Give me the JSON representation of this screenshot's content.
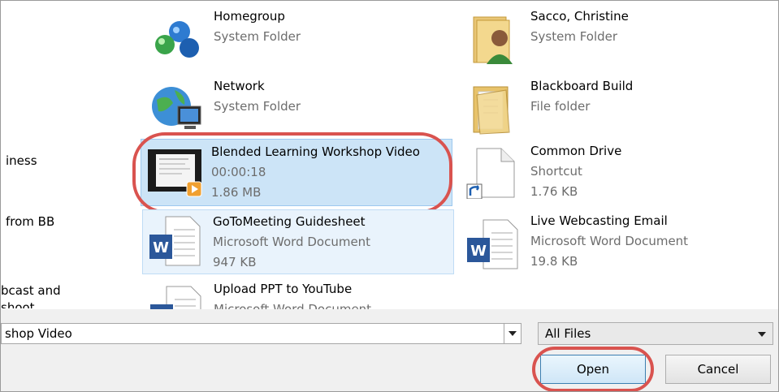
{
  "nav": {
    "items": [
      "iness",
      "from BB",
      "bcast and",
      "shoot"
    ]
  },
  "files": [
    {
      "name": "Homegroup",
      "sub1": "System Folder",
      "sub2": ""
    },
    {
      "name": "Sacco, Christine",
      "sub1": "System Folder",
      "sub2": ""
    },
    {
      "name": "Network",
      "sub1": "System Folder",
      "sub2": ""
    },
    {
      "name": "Blackboard Build",
      "sub1": "File folder",
      "sub2": ""
    },
    {
      "name": "Blended Learning Workshop Video",
      "sub1": "00:00:18",
      "sub2": "1.86 MB"
    },
    {
      "name": "Common Drive",
      "sub1": "Shortcut",
      "sub2": "1.76 KB"
    },
    {
      "name": "GoToMeeting Guidesheet",
      "sub1": "Microsoft Word Document",
      "sub2": "947 KB"
    },
    {
      "name": "Live Webcasting Email",
      "sub1": "Microsoft Word Document",
      "sub2": "19.8 KB"
    },
    {
      "name": "Upload PPT to YouTube",
      "sub1": "Microsoft Word Document",
      "sub2": ""
    }
  ],
  "bottom": {
    "filename_value": "shop Video",
    "filter_value": "All Files",
    "open_label": "Open",
    "cancel_label": "Cancel"
  },
  "colors": {
    "selected_bg": "#cce4f7",
    "highlight": "#d9534f",
    "word_blue": "#2b579a"
  }
}
